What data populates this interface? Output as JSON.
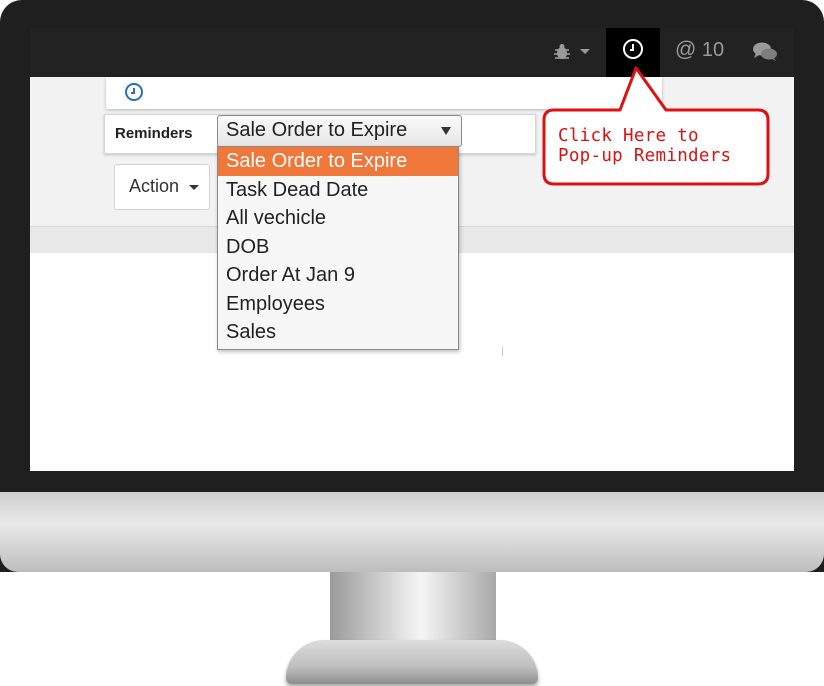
{
  "navbar": {
    "mention_count": "10",
    "icons": [
      "bug-icon",
      "clock-icon",
      "at-icon",
      "chat-icon"
    ]
  },
  "reminders": {
    "label": "Reminders",
    "selected": "Sale Order to Expire",
    "options": [
      "Sale Order to Expire",
      "Task Dead Date",
      "All vechicle",
      "DOB",
      "Order At Jan 9",
      "Employees",
      "Sales"
    ]
  },
  "toolbar": {
    "action_label": "Action"
  },
  "callout": {
    "line1": "Click Here to",
    "line2": "Pop-up Reminders",
    "color": "#dd1111"
  },
  "colors": {
    "navbar": "#222222",
    "selected_option": "#f0773a",
    "clock_icon": "#2a6fb5"
  }
}
